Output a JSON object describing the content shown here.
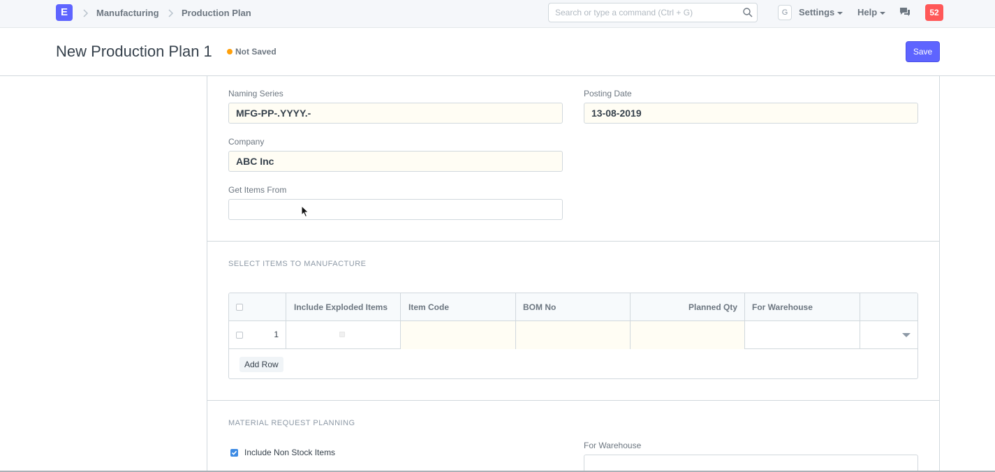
{
  "navbar": {
    "logo_letter": "E",
    "breadcrumbs": [
      "Manufacturing",
      "Production Plan"
    ],
    "search_placeholder": "Search or type a command (Ctrl + G)",
    "g_letter": "G",
    "settings_label": "Settings",
    "help_label": "Help",
    "notification_count": "52",
    "accent_color": "#5e64ff"
  },
  "page": {
    "title": "New Production Plan 1",
    "status": "Not Saved",
    "save_label": "Save"
  },
  "form": {
    "naming_series": {
      "label": "Naming Series",
      "value": "MFG-PP-.YYYY.-"
    },
    "posting_date": {
      "label": "Posting Date",
      "value": "13-08-2019"
    },
    "company": {
      "label": "Company",
      "value": "ABC Inc"
    },
    "get_items_from": {
      "label": "Get Items From",
      "value": ""
    }
  },
  "items_section": {
    "heading": "SELECT ITEMS TO MANUFACTURE",
    "columns": [
      "Include Exploded Items",
      "Item Code",
      "BOM No",
      "Planned Qty",
      "For Warehouse"
    ],
    "rows": [
      {
        "idx": "1"
      }
    ],
    "add_row_label": "Add Row"
  },
  "material_section": {
    "heading": "MATERIAL REQUEST PLANNING",
    "include_non_stock_label": "Include Non Stock Items",
    "include_non_stock_checked": true,
    "for_warehouse_label": "For Warehouse",
    "for_warehouse_value": ""
  }
}
